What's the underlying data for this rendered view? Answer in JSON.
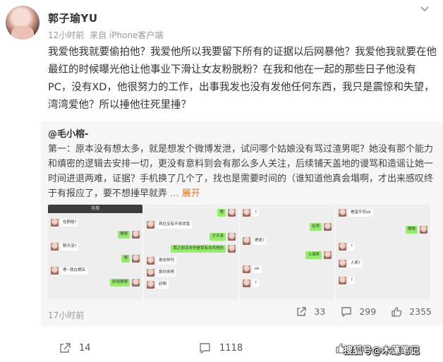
{
  "user": {
    "name": "郭子瑜YU",
    "time": "12小时前",
    "source": "来自 iPhone客户端"
  },
  "post": {
    "text": "我爱他我就要偷拍他？我爱他所以我要留下所有的证据以后网暴他？我爱他我就要在他最红的时候曝光他让他事业下滑让女友粉脱粉？在我和他在一起的那些日子他没有PC，没有XD，他很努力的工作，出事我发也没有发他任何东西，我只是震惊和失望，湾湾爱他？所以捶他往死里捶？"
  },
  "repost": {
    "author": "@毛小榕-",
    "text": "第一：原本没有想太多，就是想发个微博发泄，试问哪个姑娘没有骂过渣男呢？她没有那个能力和缜密的逻辑去安排一切，更没有意料到会有那么多人关注，后续铺天盖地的谩骂和造谣让她一时间进退两难，证据？手机换了几个了，找也是需要时间的（谁知道他真会塌啊，才出来感叹终于有报应了，要不想捶早就弄",
    "expand_label": "展开",
    "time": "17小时前",
    "share_count": "33",
    "comment_count": "299",
    "like_count": "2355",
    "images": [
      {
        "name": "chat-screenshot-1",
        "title": "毛榕",
        "messages": [
          {
            "side": "l",
            "text": "在剧组?"
          },
          {
            "side": "r",
            "text": "嗯嗯"
          },
          {
            "side": "l",
            "text": "聊天没?"
          },
          {
            "side": "r",
            "text": "嗯"
          },
          {
            "side": "l",
            "text": "嗯~我在横店"
          },
          {
            "side": "r",
            "text": "好哒嗯嗯"
          }
        ]
      },
      {
        "name": "chat-screenshot-2",
        "title": "",
        "messages": [
          {
            "side": "r",
            "text": "嗯"
          },
          {
            "side": "l",
            "text": "两位没有不来找我"
          },
          {
            "side": "r",
            "text": "才不来"
          },
          {
            "side": "r",
            "text": "我之前没去但是我有去找他的"
          },
          {
            "side": "l",
            "text": "是这样吗"
          },
          {
            "side": "l",
            "text": "那你来啊"
          },
          {
            "side": "l",
            "text": "好啊"
          }
        ]
      },
      {
        "name": "chat-screenshot-3",
        "title": "",
        "messages": [
          {
            "side": "l",
            "text": "?"
          },
          {
            "side": "r",
            "text": "在吧"
          },
          {
            "side": "l",
            "text": "嗯呢?"
          },
          {
            "side": "r",
            "text": "上海呀"
          },
          {
            "side": "l",
            "text": "ok"
          },
          {
            "side": "l",
            "text": "?"
          }
        ]
      },
      {
        "name": "chat-screenshot-4",
        "title": "",
        "messages": [
          {
            "side": "l",
            "text": "看望平安ok"
          },
          {
            "side": "r",
            "text": "嗯嗯"
          },
          {
            "side": "l",
            "text": "?"
          },
          {
            "side": "l",
            "text": "人呢?"
          },
          {
            "side": "l",
            "text": "?"
          }
        ]
      }
    ]
  },
  "footer": {
    "share_count": "14",
    "comment_count": "1118",
    "watermark": "搜狐号@木蓮笔记"
  },
  "icons": {
    "menu": "chevron-down-icon",
    "share": "share-icon",
    "comment": "comment-icon",
    "like": "thumbs-up-icon"
  }
}
